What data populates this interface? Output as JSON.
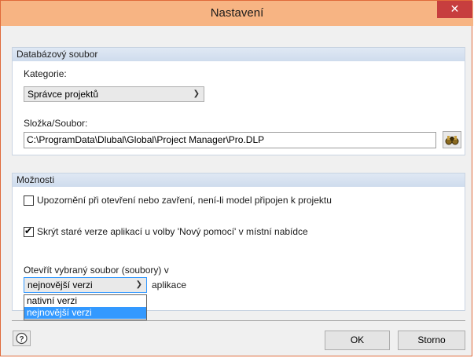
{
  "window": {
    "title": "Nastavení",
    "close_glyph": "✕"
  },
  "database_group": {
    "header": "Databázový soubor",
    "category_label": "Kategorie:",
    "category_value": "Správce projektů",
    "folder_label": "Složka/Soubor:",
    "folder_value": "C:\\ProgramData\\Dlubal\\Global\\Project Manager\\Pro.DLP",
    "browse_icon": "binoculars-icon"
  },
  "options_group": {
    "header": "Možnosti",
    "notify_label": "Upozornění při otevření nebo zavření, není-li model připojen k projektu",
    "notify_checked": false,
    "hide_label": "Skrýt staré verze aplikací u volby 'Nový pomocí' v místní nabídce",
    "hide_checked": true,
    "open_label": "Otevřít vybraný soubor (soubory) v",
    "open_value": "nejnovější verzi",
    "open_suffix": "aplikace",
    "open_options": [
      "nativní verzi",
      "nejnovější verzi"
    ]
  },
  "footer": {
    "help_icon": "help-icon",
    "ok_label": "OK",
    "cancel_label": "Storno"
  }
}
